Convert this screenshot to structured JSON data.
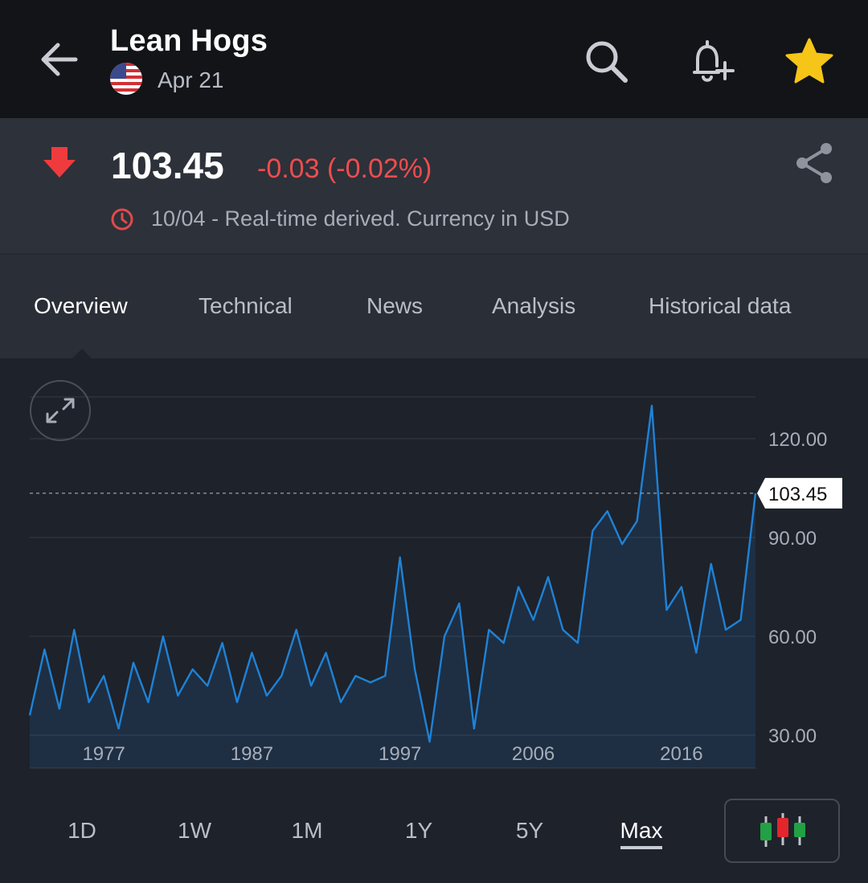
{
  "header": {
    "back_icon": "arrow-left-icon",
    "title": "Lean Hogs",
    "country_flag": "us-flag-icon",
    "subtitle": "Apr 21",
    "actions": [
      {
        "name": "search-icon"
      },
      {
        "name": "bell-plus-icon"
      },
      {
        "name": "star-icon",
        "color": "#f5c518"
      }
    ]
  },
  "quote": {
    "direction_icon": "arrow-down-icon",
    "price": "103.45",
    "change": "-0.03 (-0.02%)",
    "change_color": "#ef4d4f",
    "note": "10/04 - Real-time derived. Currency in USD",
    "share_icon": "share-icon"
  },
  "tabs": [
    {
      "label": "Overview",
      "active": true
    },
    {
      "label": "Technical"
    },
    {
      "label": "News"
    },
    {
      "label": "Analysis"
    },
    {
      "label": "Historical data"
    }
  ],
  "chart_data": {
    "type": "area",
    "x_tick_labels": [
      "1977",
      "1987",
      "1997",
      "2006",
      "2016"
    ],
    "y_tick_labels": [
      "120.00",
      "90.00",
      "60.00",
      "30.00"
    ],
    "ylim": [
      20,
      140
    ],
    "last_value_label": "103.45",
    "last_value": 103.45,
    "line_color": "#1f82d6",
    "x": [
      1972,
      1973,
      1974,
      1975,
      1976,
      1977,
      1978,
      1979,
      1980,
      1981,
      1982,
      1983,
      1984,
      1985,
      1986,
      1987,
      1988,
      1989,
      1990,
      1991,
      1992,
      1993,
      1994,
      1995,
      1996,
      1997,
      1998,
      1999,
      2000,
      2001,
      2002,
      2003,
      2004,
      2005,
      2006,
      2007,
      2008,
      2009,
      2010,
      2011,
      2012,
      2013,
      2014,
      2015,
      2016,
      2017,
      2018,
      2019,
      2020,
      2021
    ],
    "values": [
      36,
      56,
      38,
      62,
      40,
      48,
      32,
      52,
      40,
      60,
      42,
      50,
      45,
      58,
      40,
      55,
      42,
      48,
      62,
      45,
      55,
      40,
      48,
      46,
      48,
      84,
      50,
      28,
      60,
      70,
      32,
      62,
      58,
      75,
      65,
      78,
      62,
      58,
      92,
      98,
      88,
      95,
      130,
      68,
      75,
      55,
      82,
      62,
      65,
      103.45
    ]
  },
  "ranges": [
    {
      "label": "1D"
    },
    {
      "label": "1W"
    },
    {
      "label": "1M"
    },
    {
      "label": "1Y"
    },
    {
      "label": "5Y"
    },
    {
      "label": "Max",
      "active": true
    }
  ],
  "chart_type_icon": "candlestick-icon"
}
